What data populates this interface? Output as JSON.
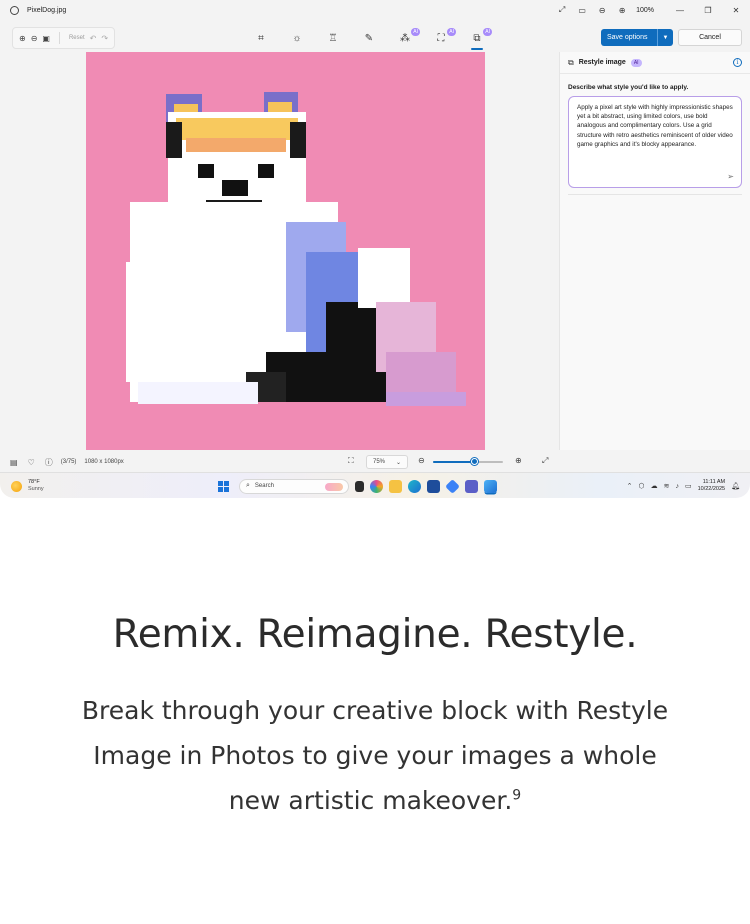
{
  "window": {
    "title": "PixelDog.jpg",
    "zoom": "100%"
  },
  "toolbar": {
    "reset_label": "Reset",
    "ai_badge": "AI",
    "save_options_label": "Save options",
    "cancel_label": "Cancel"
  },
  "panel": {
    "title": "Restyle image",
    "ai_badge": "AI",
    "prompt_label": "Describe what style you'd like to apply.",
    "prompt_value": "Apply a pixel art style with highly impressionistic shapes yet a bit abstract, using limited colors, use bold analogous and complimentary colors. Use a grid structure with retro aesthetics reminiscent of older video game graphics and it's blocky appearance."
  },
  "statusbar": {
    "counter": "(3/75)",
    "dimensions": "1080 x 1080px",
    "zoom_value": "75%",
    "zoom_fraction": 0.6
  },
  "taskbar": {
    "weather_temp": "78°F",
    "weather_cond": "Sunny",
    "search_placeholder": "Search",
    "time": "11:11 AM",
    "date": "10/22/2025"
  },
  "marketing": {
    "headline": "Remix. Reimagine. Restyle.",
    "body": "Break through your creative block with Restyle Image in Photos to give your images a whole new artistic makeover.",
    "footnote": "9"
  },
  "colors": {
    "accent": "#0f6cbd",
    "image_background": "#f08bb4",
    "ai_badge": "#a78bfa"
  }
}
